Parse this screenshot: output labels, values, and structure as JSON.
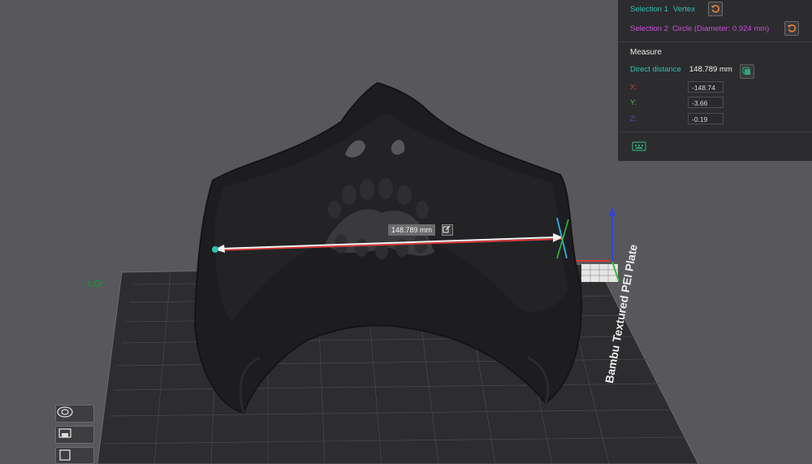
{
  "selection1": {
    "label": "Selection 1",
    "type": "Vertex"
  },
  "selection2": {
    "label": "Selection 2",
    "type": "Circle (Diameter: 0.924 mm)"
  },
  "measure": {
    "title": "Measure",
    "direct_distance_label": "Direct distance",
    "direct_distance_value": "148.789 mm",
    "x_label": "X:",
    "x_value": "-148.74",
    "y_label": "Y:",
    "y_value": "-3.66",
    "z_label": "Z:",
    "z_value": "-0.19"
  },
  "dimension_label": "148.789 mm",
  "plate_text": "Bambu Textured PEI Plate",
  "plate_corner_text": "LO",
  "colors": {
    "teal": "#2fc3b2",
    "magenta": "#c64fd6",
    "x_axis": "#d93a3a",
    "y_axis": "#31c23a",
    "z_axis": "#3145d6",
    "reset_orange": "#e8823a"
  }
}
